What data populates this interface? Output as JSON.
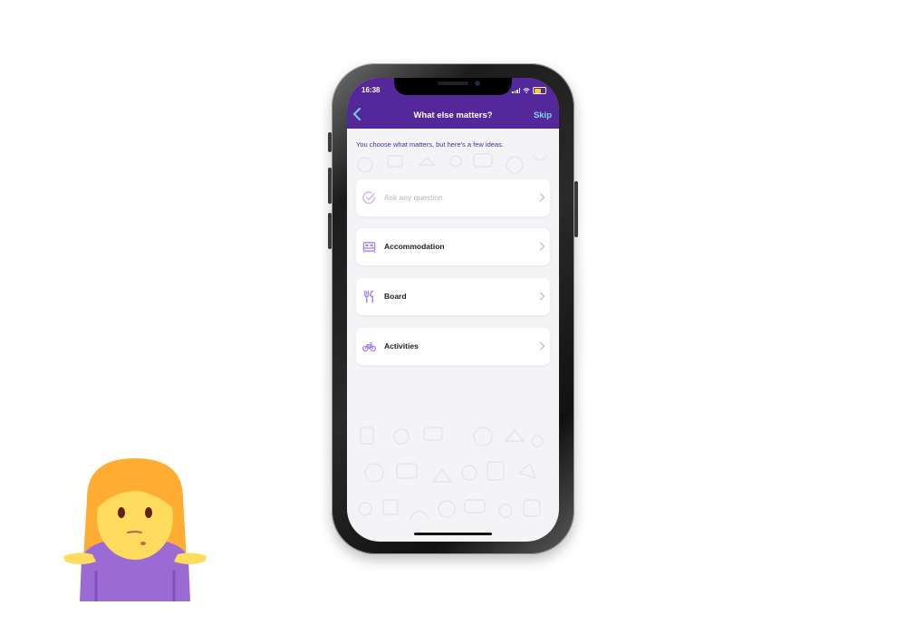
{
  "status_bar": {
    "time": "16:38"
  },
  "header": {
    "title": "What else matters?",
    "back_icon": "chevron-left-icon",
    "skip_label": "Skip"
  },
  "subtitle": "You choose what matters, but here's a few ideas.",
  "items": [
    {
      "label": "Ask any question",
      "icon": "check-circle-icon",
      "disabled": true
    },
    {
      "label": "Accommodation",
      "icon": "bed-icon",
      "disabled": false
    },
    {
      "label": "Board",
      "icon": "fork-knife-icon",
      "disabled": false
    },
    {
      "label": "Activities",
      "icon": "bicycle-icon",
      "disabled": false
    }
  ],
  "colors": {
    "brand_purple": "#54289a",
    "accent_cyan": "#74d1ea",
    "icon_purple": "#a680ec",
    "battery_yellow": "#ffc928",
    "emoji_hair": "#ffac33",
    "emoji_skin": "#ffdc5d",
    "emoji_shirt": "#9b6bd4"
  },
  "decoration": {
    "emoji": "person-shrugging-emoji"
  }
}
